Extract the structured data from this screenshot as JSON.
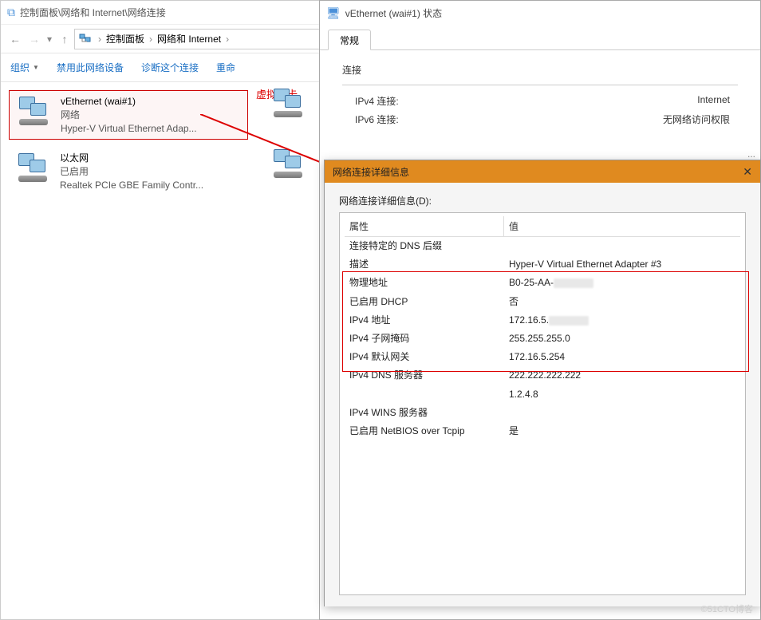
{
  "main": {
    "title": "控制面板\\网络和 Internet\\网络连接",
    "breadcrumb": [
      "控制面板",
      "网络和 Internet"
    ],
    "toolbar": {
      "organize": "组织",
      "disable": "禁用此网络设备",
      "diagnose": "诊断这个连接",
      "rename": "重命"
    },
    "adapters": [
      {
        "name": "vEthernet (wai#1)",
        "status": "网络",
        "desc": "Hyper-V Virtual Ethernet Adap..."
      },
      {
        "name": "以太网",
        "status": "已启用",
        "desc": "Realtek PCIe GBE Family Contr..."
      }
    ],
    "virtual_label": "虚拟网卡"
  },
  "status": {
    "title": "vEthernet (wai#1) 状态",
    "tab": "常规",
    "section": "连接",
    "rows": [
      {
        "label": "IPv4 连接:",
        "value": "Internet"
      },
      {
        "label": "IPv6 连接:",
        "value": "无网络访问权限"
      }
    ]
  },
  "details": {
    "title": "网络连接详细信息",
    "label": "网络连接详细信息(D):",
    "col_prop": "属性",
    "col_val": "值",
    "rows": [
      {
        "prop": "连接特定的 DNS 后缀",
        "val": ""
      },
      {
        "prop": "描述",
        "val": "Hyper-V Virtual Ethernet Adapter #3"
      },
      {
        "prop": "物理地址",
        "val": "B0-25-AA-",
        "redacted": true
      },
      {
        "prop": "已启用 DHCP",
        "val": "否"
      },
      {
        "prop": "IPv4 地址",
        "val": "172.16.5.",
        "redacted": true
      },
      {
        "prop": "IPv4 子网掩码",
        "val": "255.255.255.0"
      },
      {
        "prop": "IPv4 默认网关",
        "val": "172.16.5.254"
      },
      {
        "prop": "IPv4 DNS 服务器",
        "val": "222.222.222.222"
      },
      {
        "prop": "",
        "val": "1.2.4.8"
      },
      {
        "prop": "IPv4 WINS 服务器",
        "val": ""
      },
      {
        "prop": "已启用 NetBIOS over Tcpip",
        "val": "是"
      }
    ]
  },
  "footer": "©51CTO博客"
}
